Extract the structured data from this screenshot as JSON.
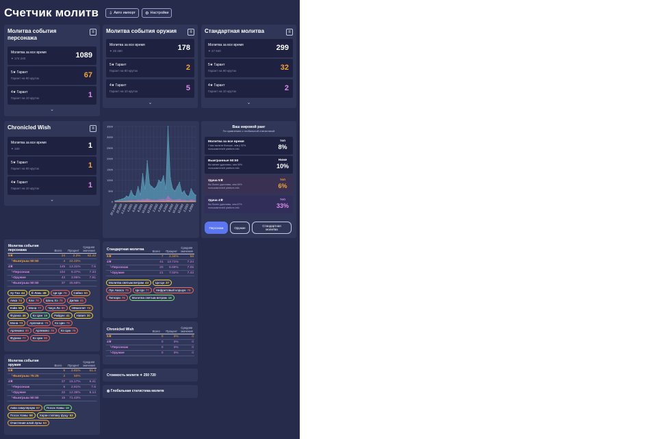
{
  "header": {
    "title": "Счетчик молитв",
    "auto_import": "Авто импорт",
    "settings": "Настройки"
  },
  "banners": [
    {
      "title": "Молитва события персонажа",
      "rows": [
        {
          "label": "Молитва за все время",
          "sub": "✦ 174 240",
          "value": "1089",
          "cls": "cw"
        },
        {
          "label": "5★ Гарант",
          "sub": "Гарант на 90 круток",
          "value": "67",
          "cls": "c5"
        },
        {
          "label": "4★ Гарант",
          "sub": "Гарант на 10 круток",
          "value": "1",
          "cls": "c4"
        }
      ]
    },
    {
      "title": "Молитва события оружия",
      "rows": [
        {
          "label": "Молитва за все время",
          "sub": "✦ 28 480",
          "value": "178",
          "cls": "cw"
        },
        {
          "label": "5★ Гарант",
          "sub": "Гарант на 80 круток",
          "value": "2",
          "cls": "c5"
        },
        {
          "label": "4★ Гарант",
          "sub": "Гарант на 10 круток",
          "value": "5",
          "cls": "c4"
        }
      ]
    },
    {
      "title": "Стандартная молитва",
      "rows": [
        {
          "label": "Молитва за все время",
          "sub": "✦ 47 840",
          "value": "299",
          "cls": "cw"
        },
        {
          "label": "5★ Гарант",
          "sub": "Гарант на 90 круток",
          "value": "32",
          "cls": "c5"
        },
        {
          "label": "4★ Гарант",
          "sub": "Гарант на 10 круток",
          "value": "2",
          "cls": "c4"
        }
      ]
    },
    {
      "title": "Chronicled Wish",
      "rows": [
        {
          "label": "Молитва за все время",
          "sub": "✦ 160",
          "value": "1",
          "cls": "cw"
        },
        {
          "label": "5★ Гарант",
          "sub": "Гарант на 90 круток",
          "value": "1",
          "cls": "c5"
        },
        {
          "label": "4★ Гарант",
          "sub": "Гарант на 10 круток",
          "value": "1",
          "cls": "c4"
        }
      ]
    }
  ],
  "chart_data": {
    "type": "area",
    "y_ticks": [
      "0",
      "500",
      "1000",
      "1500",
      "2000",
      "2500",
      "3000",
      "3500"
    ],
    "ylim": [
      0,
      3500
    ],
    "x": [
      "20.1.2020",
      "22.2020",
      "3.2.2021",
      "4.2021",
      "6.2021",
      "8.2021",
      "10.2021",
      "12.2021",
      "2.2022",
      "4.2022",
      "6.2022",
      "8.2022",
      "10.2022",
      "12.2022",
      "2.2023",
      "4.2023"
    ],
    "series": [
      {
        "color": "#5a9cb8",
        "values": [
          40,
          60,
          90,
          120,
          160,
          260,
          220,
          520,
          300,
          250,
          700,
          320,
          1300,
          600,
          1900,
          800,
          700,
          600,
          700,
          1000,
          900,
          1200,
          600,
          3500,
          1100,
          600,
          500,
          700,
          900,
          400,
          500,
          300,
          250,
          600,
          400,
          300
        ]
      },
      {
        "color": "#b86ec4",
        "values": [
          10,
          15,
          20,
          30,
          30,
          40,
          50,
          60,
          50,
          40,
          90,
          60,
          110,
          80,
          140,
          90,
          80,
          70,
          60,
          90,
          110,
          120,
          80,
          260,
          130,
          90,
          80,
          100,
          120,
          60,
          80,
          50,
          40,
          90,
          60,
          40
        ]
      },
      {
        "color": "#e0a860",
        "values": [
          5,
          5,
          8,
          10,
          12,
          15,
          15,
          18,
          15,
          12,
          20,
          18,
          25,
          22,
          28,
          22,
          20,
          18,
          15,
          20,
          22,
          25,
          20,
          40,
          25,
          18,
          15,
          20,
          22,
          15,
          18,
          12,
          10,
          18,
          15,
          10
        ]
      }
    ]
  },
  "ranking": {
    "title": "Ваш мировой ранг",
    "subtitle": "По сравнению с глобальной статистикой",
    "rows": [
      {
        "l1": "Молитва за все время",
        "l2": "У вас молитв больше, чем у 92% пользователей platform.info",
        "rp": "топ",
        "rv": "8%",
        "cls": "cw",
        "bg": "#1e2240"
      },
      {
        "l1": "Выигранные 50:50",
        "l2": "Вы менее удачливы, чем 90% пользователей platform.info",
        "rp": "Ниже",
        "rv": "10%",
        "cls": "cw",
        "bg": "#1e2240"
      },
      {
        "l1": "Удача 5★",
        "l2": "Вы более удачливы, чем 94% пользователей platform.info",
        "rp": "топ",
        "rv": "6%",
        "cls": "c5",
        "bg": "#3a3152"
      },
      {
        "l1": "Удача 4★",
        "l2": "Вы более удачливы, чем 67% пользователей platform.info",
        "rp": "топ",
        "rv": "33%",
        "cls": "c4",
        "bg": "#312f5a"
      }
    ],
    "buttons": [
      "Персонаж",
      "Оружие",
      "Стандартная молитва"
    ]
  },
  "tables": {
    "headers": [
      "Всего",
      "Процент",
      "Средняя значения"
    ],
    "char": {
      "title": "Молитва события персонажа",
      "rows": [
        {
          "name": "5★",
          "cls": "c5",
          "indent": 0,
          "v": [
            "24",
            "2.2%",
            "62.42"
          ]
        },
        {
          "name": "└Выигрыш 50:50",
          "cls": "c5",
          "indent": 1,
          "v": [
            "4",
            "22.22%",
            ""
          ]
        },
        {
          "name": "4★",
          "cls": "c4",
          "indent": 0,
          "v": [
            "145",
            "13.31%",
            "7.5"
          ]
        },
        {
          "name": "└Персонаж",
          "cls": "c4",
          "indent": 1,
          "v": [
            "102",
            "9.37%",
            "7.33"
          ]
        },
        {
          "name": "└Оружие",
          "cls": "c4",
          "indent": 1,
          "v": [
            "43",
            "3.95%",
            "7.91"
          ]
        },
        {
          "name": "└Выигрыш 50:50",
          "cls": "c4",
          "indent": 1,
          "v": [
            "37",
            "45.68%",
            ""
          ]
        }
      ],
      "tags": [
        [
          "Ху Тао",
          "44"
        ],
        [
          "Ё Лань",
          "48"
        ],
        [
          "Ци Ци",
          "76"
        ],
        [
          "Сайно",
          "60"
        ],
        [
          "Аяка",
          "74"
        ],
        [
          "Кли",
          "78"
        ],
        [
          "Шэнь Хэ",
          "75"
        ],
        [
          "Дилюк",
          "81"
        ],
        [
          "Кэйа",
          "58"
        ],
        [
          "Мона",
          "77"
        ],
        [
          "Чжун Ли",
          "80"
        ],
        [
          "Нёвиллет",
          "72"
        ],
        [
          "Фурина",
          "46"
        ],
        [
          "Кэ Цин",
          "19"
        ],
        [
          "Райден",
          "41"
        ],
        [
          "Навия",
          "30"
        ],
        [
          "Мона",
          "73"
        ],
        [
          "Арлекино",
          "79"
        ],
        [
          "Кэ Цин",
          "75"
        ],
        [
          "Арлекино",
          "80"
        ],
        [
          "Арлекино",
          "78"
        ],
        [
          "Кэ Цин",
          "76"
        ],
        [
          "Фурина",
          "77"
        ],
        [
          "Кэ Цин",
          "80"
        ]
      ]
    },
    "weap": {
      "title": "Молитва события оружия",
      "rows": [
        {
          "name": "5★",
          "cls": "c5",
          "indent": 0,
          "v": [
            "5",
            "2.81%",
            "51.4"
          ]
        },
        {
          "name": "└Выигрыш 75:25",
          "cls": "c5",
          "indent": 1,
          "v": [
            "2",
            "50%",
            ""
          ]
        },
        {
          "name": "4★",
          "cls": "c4",
          "indent": 0,
          "v": [
            "27",
            "15.17%",
            "6.41"
          ]
        },
        {
          "name": "└Персонаж",
          "cls": "c4",
          "indent": 1,
          "v": [
            "5",
            "2.81%",
            "7.6"
          ]
        },
        {
          "name": "└Оружие",
          "cls": "c4",
          "indent": 1,
          "v": [
            "22",
            "12.36%",
            "6.14"
          ]
        },
        {
          "name": "└Выигрыш 50:50",
          "cls": "c4",
          "indent": 1,
          "v": [
            "15",
            "71.43%",
            ""
          ]
        }
      ],
      "tags": [
        [
          "Аква симуляркум",
          "67"
        ],
        [
          "Посох Хомы",
          "18"
        ],
        [
          "Посох Хомы",
          "58"
        ],
        [
          "Харан гэппаку фуцу",
          "53"
        ],
        [
          "Очистение алой луны",
          "63"
        ]
      ]
    },
    "std": {
      "title": "Стандартная молитва",
      "rows": [
        {
          "name": "5★",
          "cls": "c5",
          "indent": 0,
          "v": [
            "7",
            "2.34%",
            "58"
          ]
        },
        {
          "name": "4★",
          "cls": "c4",
          "indent": 0,
          "v": [
            "41",
            "13.71%",
            "7.24"
          ]
        },
        {
          "name": "└Персонаж",
          "cls": "c4",
          "indent": 1,
          "v": [
            "20",
            "6.69%",
            "7.05"
          ]
        },
        {
          "name": "└Оружие",
          "cls": "c4",
          "indent": 1,
          "v": [
            "21",
            "7.02%",
            "7.43"
          ]
        }
      ],
      "tags": [
        [
          "Молитва святым ветрам",
          "43"
        ],
        [
          "Ци Ци",
          "37"
        ],
        [
          "Лук Амоса",
          "75"
        ],
        [
          "Ци Ци",
          "77"
        ],
        [
          "Нефритовый коршун",
          "76"
        ],
        [
          "Тигнари",
          "76"
        ],
        [
          "Молитва святым ветрам",
          "18"
        ]
      ]
    },
    "chron": {
      "title": "Chronicled Wish",
      "rows": [
        {
          "name": "5★",
          "cls": "c5",
          "indent": 0,
          "v": [
            "0",
            "0%",
            "0"
          ]
        },
        {
          "name": "4★",
          "cls": "c4",
          "indent": 0,
          "v": [
            "0",
            "0%",
            "0"
          ]
        },
        {
          "name": "└Персонаж",
          "cls": "c4",
          "indent": 1,
          "v": [
            "0",
            "0%",
            "0"
          ]
        },
        {
          "name": "└Оружие",
          "cls": "c4",
          "indent": 1,
          "v": [
            "0",
            "0%",
            "0"
          ]
        }
      ],
      "tags": []
    }
  },
  "cost": {
    "label": "Стоимость молитв",
    "value": "✦ 250 720"
  },
  "global": {
    "label": "Глобальная статистика молитв"
  }
}
